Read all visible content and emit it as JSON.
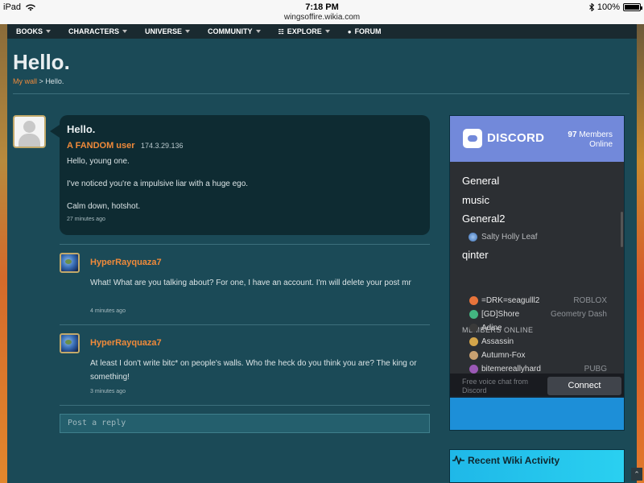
{
  "statusbar": {
    "device": "iPad",
    "time": "7:18 PM",
    "url": "wingsoffire.wikia.com",
    "battery": "100%"
  },
  "nav": {
    "items": [
      "BOOKS",
      "CHARACTERS",
      "UNIVERSE",
      "COMMUNITY",
      "EXPLORE",
      "FORUM"
    ]
  },
  "page": {
    "title": "Hello.",
    "breadcrumb_link": "My wall",
    "breadcrumb_sep": ">",
    "breadcrumb_current": "Hello."
  },
  "message": {
    "title": "Hello.",
    "author": "A FANDOM user",
    "ip": "174.3.29.136",
    "lines": [
      "Hello, young one.",
      "I've noticed you're a impulsive liar with a huge ego.",
      "Calm down, hotshot."
    ],
    "time": "27 minutes ago"
  },
  "replies": [
    {
      "author": "HyperRayquaza7",
      "text": "What! What are you talking about? For one, I have an account. I'm will delete your post mr",
      "time": "4 minutes ago"
    },
    {
      "author": "HyperRayquaza7",
      "text": "At least I don't write bitc* on people's walls. Who the heck do you think you are? The king or something!",
      "time": "3 minutes ago"
    }
  ],
  "reply_box": {
    "placeholder": "Post a reply"
  },
  "discord": {
    "brand": "DISCORD",
    "member_count": "97",
    "member_label": "Members Online",
    "channels": [
      "General",
      "music",
      "General2",
      "qinter"
    ],
    "channel_user": "Salty Holly Leaf",
    "section": "MEMBERS ONLINE",
    "members": [
      {
        "name": "=DRK=seagulll2",
        "game": "ROBLOX",
        "color": "#e8743b"
      },
      {
        "name": "[GD]Shore",
        "game": "Geometry Dash",
        "color": "#43b581"
      },
      {
        "name": "Adine",
        "game": "",
        "color": "#3a3a3a"
      },
      {
        "name": "Assassin",
        "game": "",
        "color": "#d4a54a"
      },
      {
        "name": "Autumn-Fox",
        "game": "",
        "color": "#c8a070"
      },
      {
        "name": "bitemereallyhard",
        "game": "PUBG",
        "color": "#9b59b6"
      }
    ],
    "footer": "Free voice chat from Discord",
    "connect": "Connect"
  },
  "activity": {
    "label": "Recent Wiki Activity"
  },
  "colors": {
    "accent": "#f08a3a",
    "background": "#1b4a57",
    "discord": "#7289da"
  }
}
